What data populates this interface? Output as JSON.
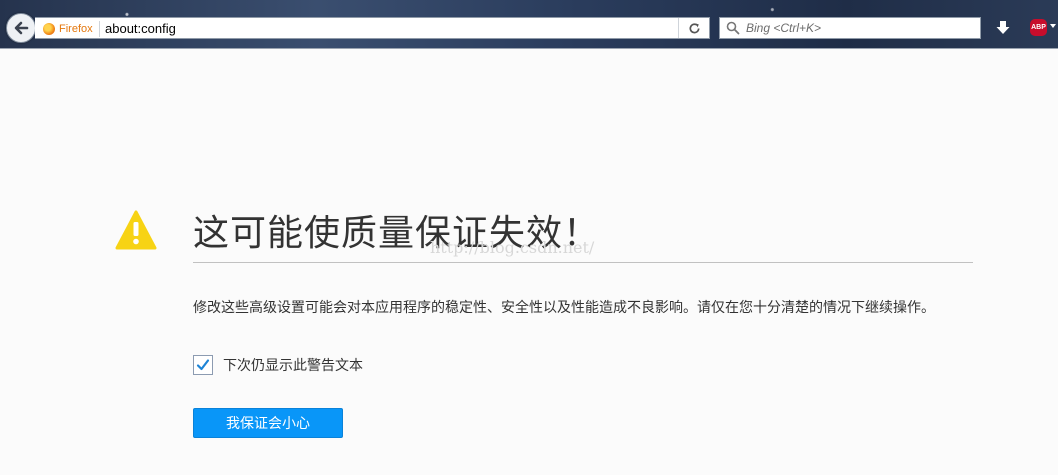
{
  "toolbar": {
    "identity_label": "Firefox",
    "url": "about:config",
    "search_placeholder": "Bing <Ctrl+K>",
    "addon_label": "ABP"
  },
  "warning": {
    "title": "这可能使质量保证失效！",
    "watermark": "http://blog.csdn.net/",
    "message": "修改这些高级设置可能会对本应用程序的稳定性、安全性以及性能造成不良影响。请仅在您十分清楚的情况下继续操作。",
    "checkbox_label": "下次仍显示此警告文本",
    "checkbox_checked": true,
    "button_label": "我保证会小心"
  },
  "colors": {
    "accent_button": "#0996f8",
    "warning_icon": "#f7d314",
    "identity_text": "#e5780e",
    "addon_badge": "#c70d2c"
  }
}
